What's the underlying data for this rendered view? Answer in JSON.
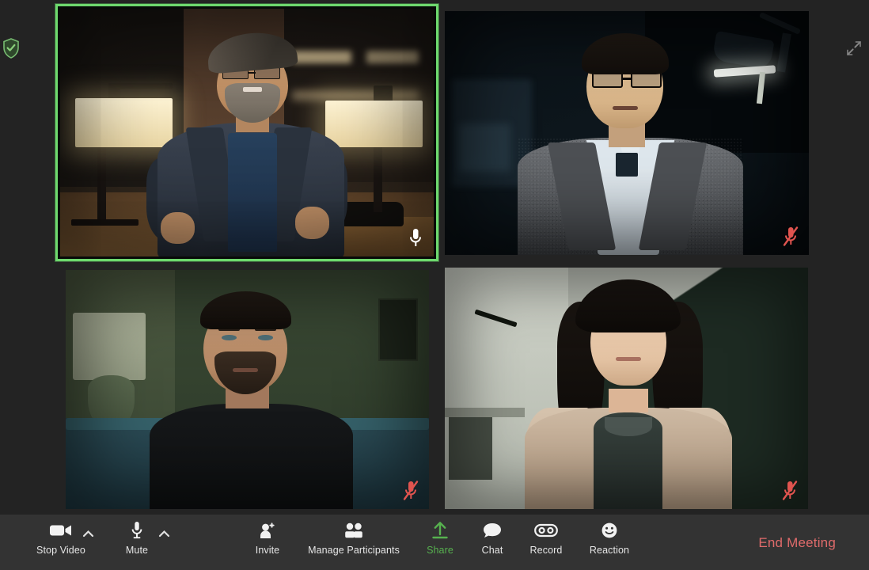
{
  "app": {
    "title": "Zoom Meeting",
    "background_color": "#232323",
    "toolbar_color": "#333333"
  },
  "indicators": {
    "encryption": {
      "name": "encrypted-shield",
      "label": "Encrypted",
      "color": "#7cc576"
    },
    "fullscreen": {
      "name": "enter-fullscreen",
      "label": "Enter Full Screen",
      "color": "#9a9a9a"
    }
  },
  "gallery": {
    "layout": "2x2",
    "active_speaker_border_color": "#6ed96e",
    "muted_icon_color": "#e0544f",
    "unmuted_icon_color": "#ffffff",
    "participants": [
      {
        "id": "participant-1",
        "scene": "sceneA",
        "active_speaker": true,
        "muted": false,
        "mic_state": "unmuted",
        "description": "Bearded man with glasses in a blue blazer, warm lounge with two table lamps"
      },
      {
        "id": "participant-2",
        "scene": "sceneB",
        "active_speaker": false,
        "muted": true,
        "mic_state": "muted",
        "description": "Man with glasses in grey tweed blazer, dark studio with desk lamp"
      },
      {
        "id": "participant-3",
        "scene": "sceneC",
        "active_speaker": false,
        "muted": true,
        "mic_state": "muted",
        "description": "Bearded man in black t-shirt on teal couch, green wall"
      },
      {
        "id": "participant-4",
        "scene": "sceneD",
        "active_speaker": false,
        "muted": true,
        "mic_state": "muted",
        "description": "Woman with long dark hair in cream cardigan, diagonal light-dark background"
      }
    ]
  },
  "toolbar": {
    "items": [
      {
        "id": "stop-video",
        "label": "Stop Video",
        "icon": "video-camera-icon",
        "has_caret": true,
        "accent": false
      },
      {
        "id": "mute",
        "label": "Mute",
        "icon": "microphone-icon",
        "has_caret": true,
        "accent": false
      },
      {
        "id": "invite",
        "label": "Invite",
        "icon": "person-add-icon",
        "has_caret": false,
        "accent": false
      },
      {
        "id": "manage-participants",
        "label": "Manage Participants",
        "icon": "people-icon",
        "has_caret": false,
        "accent": false
      },
      {
        "id": "share",
        "label": "Share",
        "icon": "share-upload-icon",
        "has_caret": false,
        "accent": true
      },
      {
        "id": "chat",
        "label": "Chat",
        "icon": "speech-bubble-icon",
        "has_caret": false,
        "accent": false
      },
      {
        "id": "record",
        "label": "Record",
        "icon": "record-tape-icon",
        "has_caret": false,
        "accent": false
      },
      {
        "id": "reaction",
        "label": "Reaction",
        "icon": "smiley-face-icon",
        "has_caret": false,
        "accent": false
      }
    ],
    "end_meeting_label": "End Meeting",
    "end_meeting_color": "#e06b6b",
    "share_accent_color": "#57b14f"
  }
}
